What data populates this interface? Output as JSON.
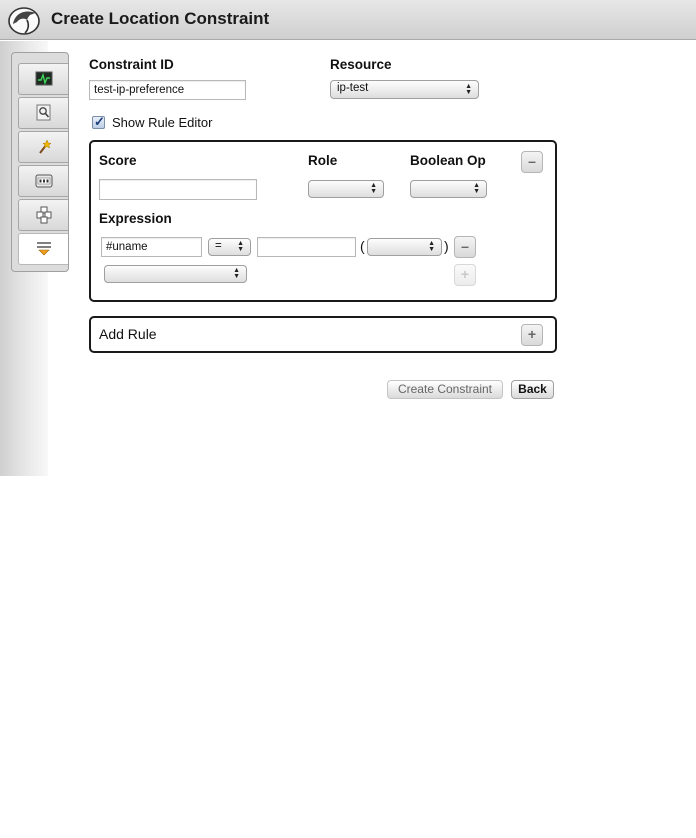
{
  "header": {
    "title": "Create Location Constraint"
  },
  "sidebar": {
    "tabs": [
      {
        "icon": "monitor-icon"
      },
      {
        "icon": "magnifier-icon"
      },
      {
        "icon": "wand-icon"
      },
      {
        "icon": "configuration-icon"
      },
      {
        "icon": "cubes-icon"
      },
      {
        "icon": "constraints-icon",
        "active": true
      }
    ]
  },
  "form": {
    "constraint_id_label": "Constraint ID",
    "constraint_id_value": "test-ip-preference",
    "resource_label": "Resource",
    "resource_value": "ip-test",
    "show_rule_editor_label": "Show Rule Editor",
    "show_rule_editor_checked": true
  },
  "rule": {
    "score_label": "Score",
    "score_value": "",
    "role_label": "Role",
    "role_value": "",
    "boolean_op_label": "Boolean Op",
    "boolean_op_value": "",
    "remove_rule": "–",
    "expression_label": "Expression",
    "expression": {
      "attribute": "#uname",
      "operation": "=",
      "value": "",
      "open_paren": "(",
      "type_value": "",
      "close_paren": ")",
      "remove": "–",
      "add": "+",
      "new_expression_value": ""
    }
  },
  "add_rule": {
    "label": "Add Rule",
    "button": "+"
  },
  "actions": {
    "create": "Create Constraint",
    "back": "Back"
  }
}
